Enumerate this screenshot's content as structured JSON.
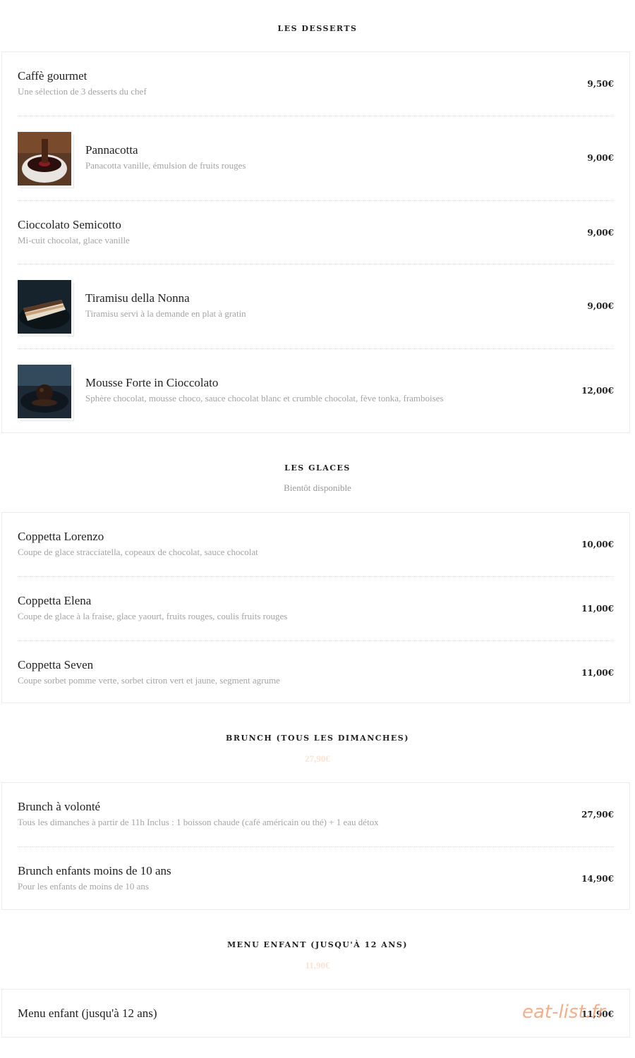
{
  "sections": {
    "desserts": {
      "title": "LES DESSERTS",
      "items": [
        {
          "name": "Caffè gourmet",
          "desc": "Une sélection de 3 desserts du chef",
          "price": "9,50€"
        },
        {
          "name": "Pannacotta",
          "desc": "Panacotta vanille, émulsion de fruits rouges",
          "price": "9,00€",
          "image": "pannacotta-photo"
        },
        {
          "name": "Cioccolato Semicotto",
          "desc": "Mi-cuit chocolat, glace vanille",
          "price": "9,00€"
        },
        {
          "name": "Tiramisu della Nonna",
          "desc": "Tiramisu servi à la demande en plat à gratin",
          "price": "9,00€",
          "image": "tiramisu-photo"
        },
        {
          "name": "Mousse Forte in Cioccolato",
          "desc": "Sphère chocolat, mousse choco, sauce chocolat blanc et crumble chocolat, fève tonka, framboises",
          "price": "12,00€",
          "image": "mousse-photo"
        }
      ]
    },
    "glaces": {
      "title": "LES GLACES",
      "subtitle": "Bientôt disponible",
      "items": [
        {
          "name": "Coppetta Lorenzo",
          "desc": "Coupe de glace stracciatella, copeaux de chocolat, sauce chocolat",
          "price": "10,00€"
        },
        {
          "name": "Coppetta Elena",
          "desc": "Coupe de glace à la fraise, glace yaourt, fruits rouges, coulis fruits rouges",
          "price": "11,00€"
        },
        {
          "name": "Coppetta Seven",
          "desc": "Coupe sorbet pomme verte, sorbet citron vert et jaune, segment agrume",
          "price": "11,00€"
        }
      ]
    },
    "brunch": {
      "title": "BRUNCH (TOUS LES DIMANCHES)",
      "price": "27,90€",
      "items": [
        {
          "name": "Brunch à volonté",
          "desc": "Tous les dimanches à partir de 11h Inclus : 1 boisson chaude (café américain ou thé) + 1 eau détox",
          "price": "27,90€"
        },
        {
          "name": "Brunch enfants moins de 10 ans",
          "desc": "Pour les enfants de moins de 10 ans",
          "price": "14,90€"
        }
      ]
    },
    "enfant": {
      "title": "MENU ENFANT (JUSQU'À 12 ANS)",
      "price": "11,90€",
      "items": [
        {
          "name": "Menu enfant (jusqu'à 12 ans)",
          "price": "11,90€"
        }
      ]
    }
  },
  "watermark": "eat-list.fr",
  "colors": {
    "accent_price": "#fbe3d6",
    "watermark": "#f0a277",
    "muted": "#a4a4a4"
  }
}
